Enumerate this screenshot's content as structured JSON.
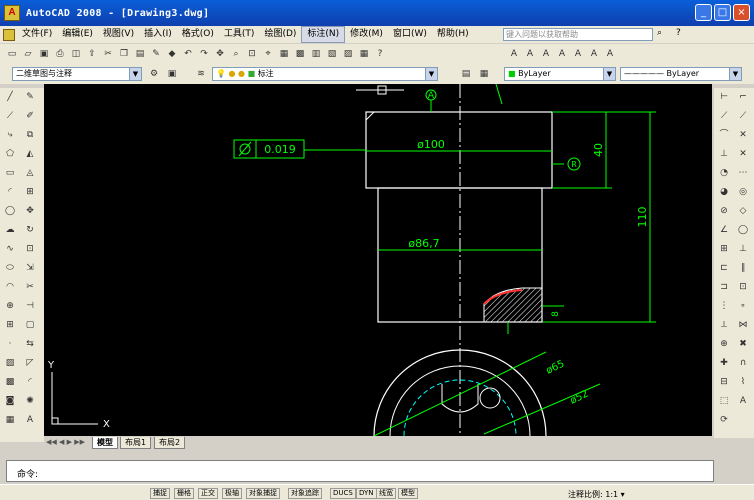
{
  "window": {
    "title": "AutoCAD 2008 - [Drawing3.dwg]",
    "app_icon": "autocad-icon",
    "controls": [
      "_",
      "□",
      "×"
    ]
  },
  "menu": {
    "items": [
      "文件(F)",
      "编辑(E)",
      "视图(V)",
      "插入(I)",
      "格式(O)",
      "工具(T)",
      "绘图(D)",
      "标注(N)",
      "修改(M)",
      "窗口(W)",
      "帮助(H)"
    ],
    "highlighted": "标注(N)",
    "help_placeholder": "键入问题以获取帮助"
  },
  "toolbars": {
    "workspace": "二维草图与注释",
    "layer": "标注",
    "color": "ByLayer",
    "linetype": "ByLayer"
  },
  "drawing": {
    "datum_label": "A",
    "tolerance_value": "0.019",
    "dim_d100": "ø100",
    "dim_40": "40",
    "dim_110": "110",
    "dim_d86": "ø86,7",
    "dim_8": "8",
    "dim_d65": "ø65",
    "dim_d52": "ø52",
    "ref_label": "R",
    "ucs_x": "X",
    "ucs_y": "Y"
  },
  "tabs": {
    "items": [
      "模型",
      "布局1",
      "布局2"
    ],
    "active": "模型"
  },
  "command": {
    "prompt": "命令:"
  },
  "status": {
    "buttons": [
      "捕捉",
      "栅格",
      "正交",
      "极轴",
      "对象捕捉",
      "对象追踪",
      "DUCS",
      "DYN",
      "线宽",
      "模型"
    ],
    "annotation_scale": "注释比例: 1:1 ▾"
  },
  "colors": {
    "canvas": "#000000",
    "geometry": "#ffffff",
    "dimension": "#00ff00",
    "title_bar": "#0a5fd8",
    "highlight": "#d7dbe8"
  }
}
